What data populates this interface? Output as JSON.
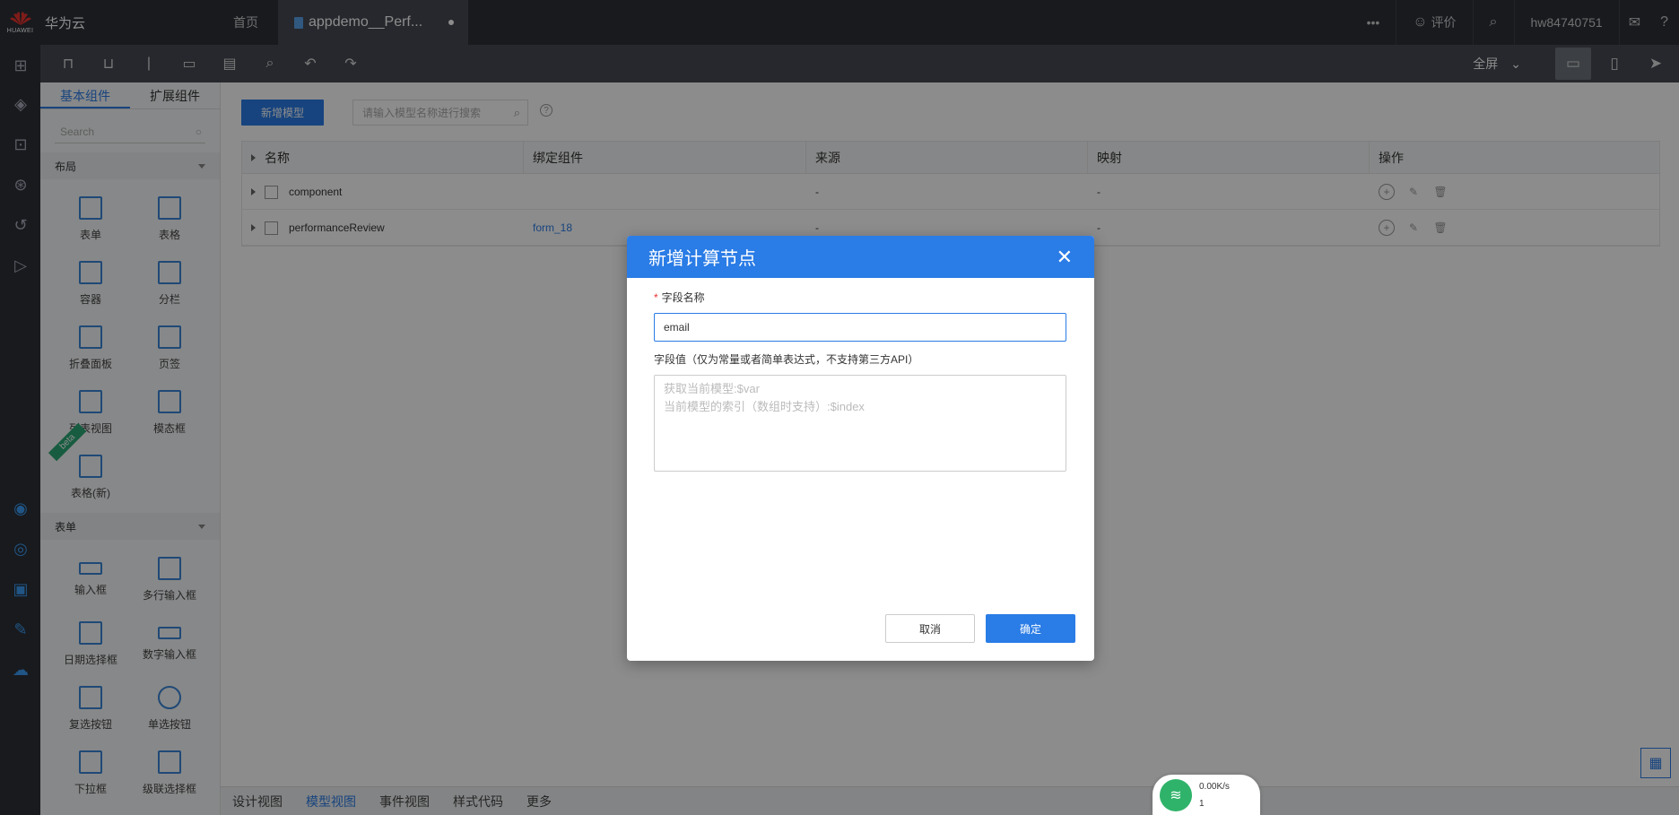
{
  "topbar": {
    "brand_sub": "HUAWEI",
    "brand": "华为云",
    "home": "首页",
    "active_tab": "appdemo__Perf...",
    "more": "•••",
    "feedback": "评价",
    "user": "hw84740751"
  },
  "toolbar": {
    "fullscreen": "全屏"
  },
  "panel": {
    "tabs": [
      "基本组件",
      "扩展组件"
    ],
    "search_placeholder": "Search",
    "sections": [
      {
        "title": "布局",
        "items": [
          "表单",
          "表格",
          "容器",
          "分栏",
          "折叠面板",
          "页签",
          "列表视图",
          "模态框",
          "表格(新)"
        ]
      },
      {
        "title": "表单",
        "items": [
          "输入框",
          "多行输入框",
          "日期选择框",
          "数字输入框",
          "复选按钮",
          "单选按钮",
          "下拉框",
          "级联选择框"
        ]
      }
    ],
    "beta_label": "beta"
  },
  "main": {
    "add_button": "新增模型",
    "search_placeholder": "请输入模型名称进行搜索",
    "help": "?",
    "columns": [
      "名称",
      "绑定组件",
      "来源",
      "映射",
      "操作"
    ],
    "rows": [
      {
        "name": "component",
        "bind": "",
        "source": "-",
        "mapping": "-"
      },
      {
        "name": "performanceReview",
        "bind": "form_18",
        "source": "-",
        "mapping": "-"
      }
    ]
  },
  "bottom_tabs": [
    "设计视图",
    "模型视图",
    "事件视图",
    "样式代码",
    "更多"
  ],
  "modal": {
    "title": "新增计算节点",
    "field_name_label": "字段名称",
    "field_name_value": "email",
    "field_value_label": "字段值（仅为常量或者简单表达式，不支持第三方API）",
    "field_value_placeholder_line1": "获取当前模型:$var",
    "field_value_placeholder_line2": "当前模型的索引（数组时支持）:$index",
    "cancel": "取消",
    "confirm": "确定"
  },
  "net": {
    "speed": "0.00K/s",
    "count": "1"
  },
  "colors": {
    "accent": "#2a7ce6",
    "topbar": "#2d3137",
    "toolbar": "#454a52"
  }
}
